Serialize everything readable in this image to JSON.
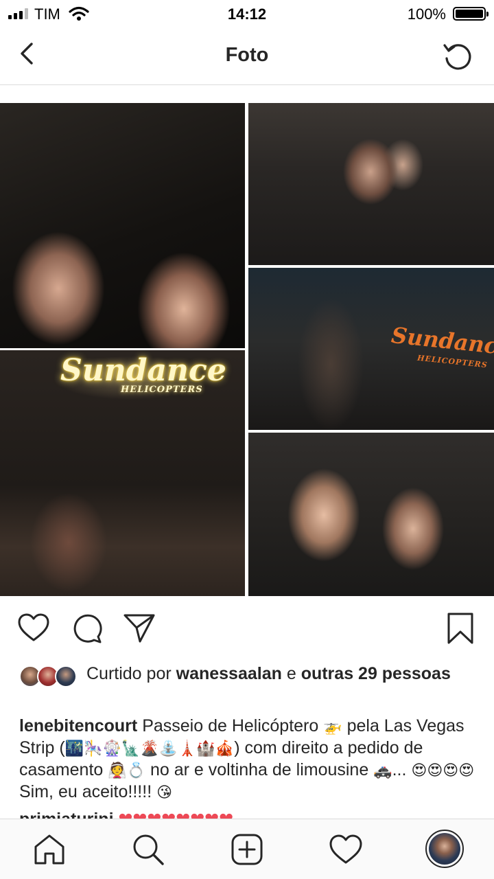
{
  "status_bar": {
    "carrier": "TIM",
    "time": "14:12",
    "battery": "100%",
    "signal_bars_active": 3,
    "signal_bars_total": 4
  },
  "nav": {
    "title": "Foto",
    "back_icon": "chevron-left-icon",
    "refresh_icon": "refresh-icon"
  },
  "post": {
    "photo_icons": [
      "heart-icon",
      "comment-icon",
      "share-icon",
      "bookmark-icon"
    ],
    "sign_text": "Sundance",
    "sign_sub_text": "HELICOPTERS",
    "likes": {
      "prefix": "Curtido por ",
      "user": "wanessaalan",
      "middle": " e ",
      "others": "outras 29 pessoas"
    },
    "caption": {
      "username": "lenebitencourt",
      "text1": " Passeio de Helicóptero ",
      "e_heli": "🚁",
      "text2": " pela Las Vegas Strip (",
      "e_places": "🌃🎠🎡🗽🌋⛲🗼🏰🎪",
      "text3": ") com direito a pedido de casamento ",
      "e_ring": "👰💍",
      "text4": " no ar e voltinha de limousine ",
      "e_car": "🚓",
      "text5": "... ",
      "e_love": "😍😍😍😍",
      "text6": " Sim, eu aceito!!!!! ",
      "e_kiss": "😘"
    },
    "next_comment": {
      "username": "primiaturini",
      "hearts": "❤❤❤❤❤❤❤❤"
    }
  },
  "tabbar": {
    "icons": [
      "home-icon",
      "search-icon",
      "new-post-icon",
      "activity-heart-icon",
      "profile-avatar"
    ]
  },
  "colors": {
    "text": "#262626",
    "divider": "#dbdbdb",
    "like_red": "#ed4956"
  }
}
